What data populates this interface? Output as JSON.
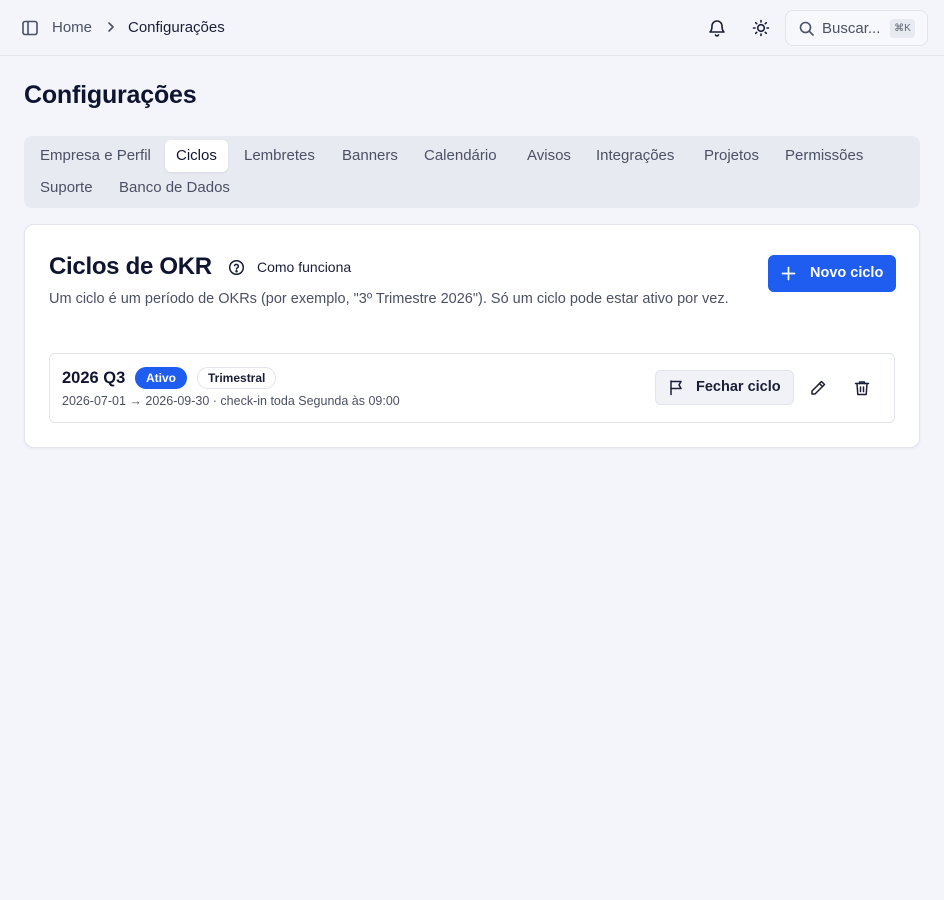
{
  "breadcrumb": {
    "home": "Home",
    "current": "Configurações"
  },
  "search": {
    "label": "Buscar...",
    "shortcut": "⌘K"
  },
  "page": {
    "title": "Configurações"
  },
  "tabs": [
    {
      "label": "Empresa e Perfil",
      "active": false
    },
    {
      "label": "Ciclos",
      "active": true
    },
    {
      "label": "Lembretes",
      "active": false
    },
    {
      "label": "Banners",
      "active": false
    },
    {
      "label": "Calendário",
      "active": false
    },
    {
      "label": "Avisos",
      "active": false
    },
    {
      "label": "Integrações",
      "active": false
    },
    {
      "label": "Projetos",
      "active": false
    },
    {
      "label": "Permissões",
      "active": false
    },
    {
      "label": "Suporte",
      "active": false
    },
    {
      "label": "Banco de Dados",
      "active": false
    }
  ],
  "card": {
    "title": "Ciclos de OKR",
    "how_label": "Como funciona",
    "description": "Um ciclo é um período de OKRs (por exemplo, \"3º Trimestre 2026\"). Só um ciclo pode estar ativo por vez.",
    "new_button": "Novo ciclo"
  },
  "cycles": [
    {
      "name": "2026 Q3",
      "status": "Ativo",
      "type": "Trimestral",
      "meta": "2026-07-01 → 2026-09-30 · check-in toda Segunda às 09:00",
      "close_label": "Fechar ciclo"
    }
  ],
  "colors": {
    "accent": "#1f5cf0",
    "background": "#f4f5fb",
    "text": "#0f1530"
  }
}
